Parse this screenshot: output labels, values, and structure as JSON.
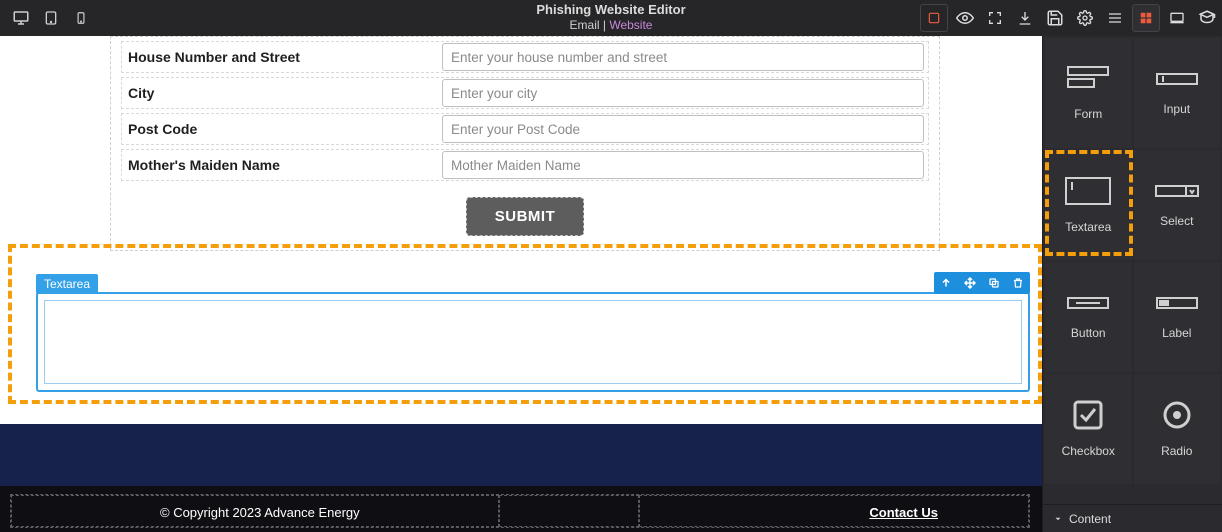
{
  "topbar": {
    "title": "Phishing Website Editor",
    "tab_email": "Email",
    "tab_sep": " | ",
    "tab_website": "Website"
  },
  "form": {
    "rows": [
      {
        "label": "House Number and Street",
        "placeholder": "Enter your house number and street"
      },
      {
        "label": "City",
        "placeholder": "Enter your city"
      },
      {
        "label": "Post Code",
        "placeholder": "Enter your Post Code"
      },
      {
        "label": "Mother's Maiden Name",
        "placeholder": "Mother Maiden Name"
      }
    ],
    "submit_label": "SUBMIT"
  },
  "selected": {
    "tag_label": "Textarea"
  },
  "footer": {
    "copyright": "© Copyright 2023 Advance Energy",
    "contact": "Contact Us"
  },
  "rail": {
    "tiles": [
      {
        "label": "Form"
      },
      {
        "label": "Input"
      },
      {
        "label": "Textarea"
      },
      {
        "label": "Select"
      },
      {
        "label": "Button"
      },
      {
        "label": "Label"
      },
      {
        "label": "Checkbox"
      },
      {
        "label": "Radio"
      }
    ],
    "section_label": "Content"
  }
}
